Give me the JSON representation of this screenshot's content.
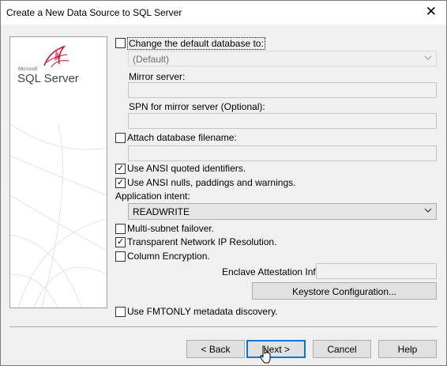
{
  "window": {
    "title": "Create a New Data Source to SQL Server"
  },
  "banner": {
    "brand_small": "Microsoft",
    "brand": "SQL Server"
  },
  "options": {
    "change_db_label": "Change the default database to:",
    "change_db_checked": false,
    "default_db_value": "(Default)",
    "mirror_label": "Mirror server:",
    "mirror_value": "",
    "spn_label": "SPN for mirror server (Optional):",
    "spn_value": "",
    "attach_label": "Attach database filename:",
    "attach_checked": false,
    "attach_value": "",
    "ansi_quoted_label": "Use ANSI quoted identifiers.",
    "ansi_quoted_checked": true,
    "ansi_nulls_label": "Use ANSI nulls, paddings and warnings.",
    "ansi_nulls_checked": true,
    "app_intent_label": "Application intent:",
    "app_intent_value": "READWRITE",
    "multisubnet_label": "Multi-subnet failover.",
    "multisubnet_checked": false,
    "tnir_label": "Transparent Network IP Resolution.",
    "tnir_checked": true,
    "column_enc_label": "Column Encryption.",
    "column_enc_checked": false,
    "enclave_label": "Enclave Attestation Info:",
    "enclave_value": "",
    "keystore_button": "Keystore Configuration...",
    "fmtonly_label": "Use FMTONLY metadata discovery.",
    "fmtonly_checked": false
  },
  "footer": {
    "back": "< Back",
    "next": "Next >",
    "cancel": "Cancel",
    "help": "Help"
  },
  "colors": {
    "accent": "#0078d7",
    "window_bg": "#f0f0f0",
    "logo_red": "#c8102e"
  },
  "icons": {
    "close": "close-icon",
    "dropdown": "chevron-down-icon",
    "check": "check-icon",
    "logo": "sql-server-logo-icon",
    "cursor": "mouse-cursor-icon"
  }
}
